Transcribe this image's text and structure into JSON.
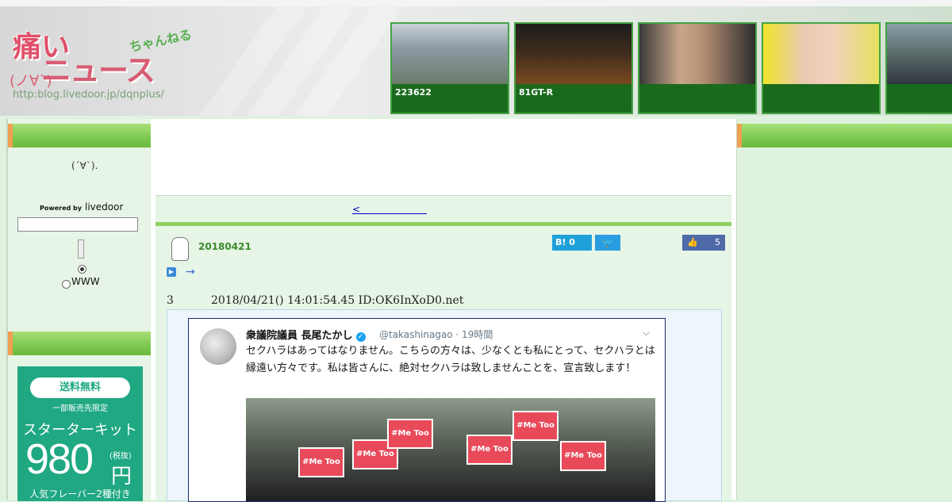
{
  "header": {
    "logo_main": "痛い",
    "logo_sub": "ニュース",
    "logo_kana": "ちゃんねる",
    "logo_face": "(ノ∀`)",
    "logo_url": "http:blog.livedoor.jp/dqnplus/"
  },
  "thumbnails": [
    {
      "caption": "223622"
    },
    {
      "caption": "81GT-R"
    },
    {
      "caption": ""
    },
    {
      "caption": ""
    },
    {
      "caption": ""
    }
  ],
  "sidebar": {
    "emoticon": "(´∀`).",
    "powered_by": "Powered by",
    "livedoor": "livedoor",
    "radio_label": "WWW"
  },
  "ad": {
    "free_shipping": "送料無料",
    "limited": "一部販売先限定",
    "kit": "スターターキット",
    "price": "980",
    "tax": "(税抜)",
    "yen": "円",
    "flavor": "人気フレーバー2種付き"
  },
  "nav": {
    "prev_link": "<　　　　　　　"
  },
  "post": {
    "date": "20180421",
    "hatena_count": "0",
    "like_count": "5",
    "arrow": "→",
    "res_number": "3",
    "res_info": "2018/04/21() 14:01:54.45 ID:OK6InXoD0.net"
  },
  "tweet": {
    "name": "衆議院議員 長尾たかし",
    "handle": "@takashinagao · 19時間",
    "body": "セクハラはあってはなりません。こちらの方々は、少なくとも私にとって、セクハラとは縁遠い方々です。私は皆さんに、絶対セクハラは致しませんことを、宣言致します！",
    "signs": [
      "#Me Too",
      "#Me Too",
      "#Me Too",
      "#Me Too",
      "#Me Too",
      "#Me Too"
    ]
  },
  "colors": {
    "accent_green": "#7cc84e",
    "dark_green": "#1a6a1e",
    "ad_teal": "#1fa882",
    "link_blue": "#0000cc"
  }
}
